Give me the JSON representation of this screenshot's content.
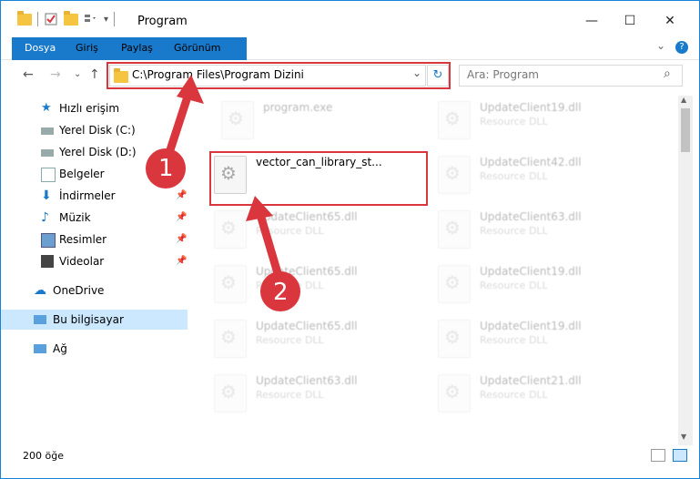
{
  "window": {
    "title": "Program",
    "controls": {
      "minimize": "—",
      "maximize": "☐",
      "close": "✕"
    }
  },
  "ribbon": {
    "tabs": [
      "Dosya",
      "Giriş",
      "Paylaş",
      "Görünüm"
    ],
    "expand_icon": "⌄",
    "help_icon": "?"
  },
  "nav": {
    "back": "←",
    "forward": "→",
    "recent": "⌄",
    "up": "↑",
    "address": "C:\\Program Files\\Program Dizini",
    "address_dropdown": "⌄",
    "refresh": "↻",
    "search_placeholder": "Ara: Program",
    "search_icon": "⌕"
  },
  "sidebar": {
    "items": [
      {
        "label": "Hızlı erişim",
        "icon": "star-icon"
      },
      {
        "label": "Yerel Disk (C:)",
        "icon": "drive-icon"
      },
      {
        "label": "Yerel Disk (D:)",
        "icon": "drive-icon"
      },
      {
        "label": "Belgeler",
        "icon": "documents-icon"
      },
      {
        "label": "İndirmeler",
        "icon": "download-icon",
        "pinned": true
      },
      {
        "label": "Müzik",
        "icon": "music-icon",
        "pinned": true
      },
      {
        "label": "Resimler",
        "icon": "pictures-icon",
        "pinned": true
      },
      {
        "label": "Videolar",
        "icon": "videos-icon",
        "pinned": true
      },
      {
        "label": "OneDrive",
        "icon": "cloud-icon"
      },
      {
        "label": "Bu bilgisayar",
        "icon": "computer-icon",
        "selected": true
      },
      {
        "label": "Ağ",
        "icon": "network-icon"
      }
    ]
  },
  "files": {
    "left": [
      {
        "name": "program.exe",
        "desc": ""
      },
      {
        "name": "vector_can_library_st...",
        "desc": ""
      },
      {
        "name": "UpdateClient65.dll",
        "desc": "Resource DLL"
      },
      {
        "name": "UpdateClient65.dll",
        "desc": "Resource DLL"
      },
      {
        "name": "UpdateClient65.dll",
        "desc": "Resource DLL"
      },
      {
        "name": "UpdateClient63.dll",
        "desc": "Resource DLL"
      }
    ],
    "right": [
      {
        "name": "UpdateClient19.dll",
        "desc": "Resource DLL"
      },
      {
        "name": "UpdateClient42.dll",
        "desc": "Resource DLL"
      },
      {
        "name": "UpdateClient63.dll",
        "desc": "Resource DLL"
      },
      {
        "name": "UpdateClient19.dll",
        "desc": "Resource DLL"
      },
      {
        "name": "UpdateClient19.dll",
        "desc": "Resource DLL"
      },
      {
        "name": "UpdateClient21.dll",
        "desc": "Resource DLL"
      }
    ]
  },
  "status": {
    "count": "200 öğe"
  },
  "callouts": [
    "1",
    "2"
  ],
  "colors": {
    "accent": "#1979ca",
    "annotation": "#d9363e"
  }
}
